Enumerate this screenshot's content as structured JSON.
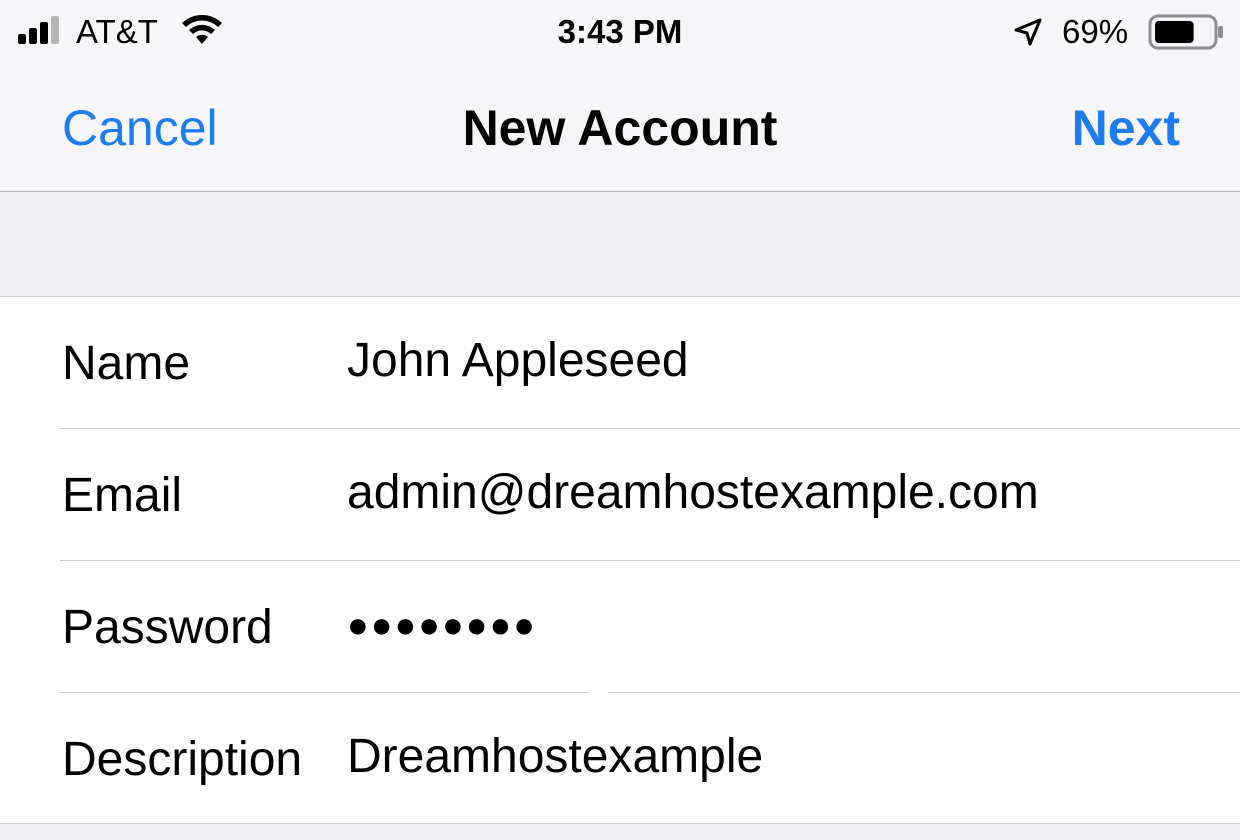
{
  "status_bar": {
    "carrier": "AT&T",
    "time": "3:43 PM",
    "battery_percent": "69%",
    "battery_level": 0.69,
    "icons": [
      "signal-icon",
      "wifi-icon",
      "location-arrow-icon",
      "battery-icon"
    ]
  },
  "nav": {
    "cancel_label": "Cancel",
    "title": "New Account",
    "next_label": "Next",
    "accent_color": "#1d7cf2"
  },
  "form": {
    "fields": [
      {
        "label": "Name",
        "value": "John Appleseed"
      },
      {
        "label": "Email",
        "value": "admin@dreamhostexample.com"
      },
      {
        "label": "Password",
        "value": "●●●●●●●●"
      },
      {
        "label": "Description",
        "value": "Dreamhostexample"
      }
    ]
  }
}
